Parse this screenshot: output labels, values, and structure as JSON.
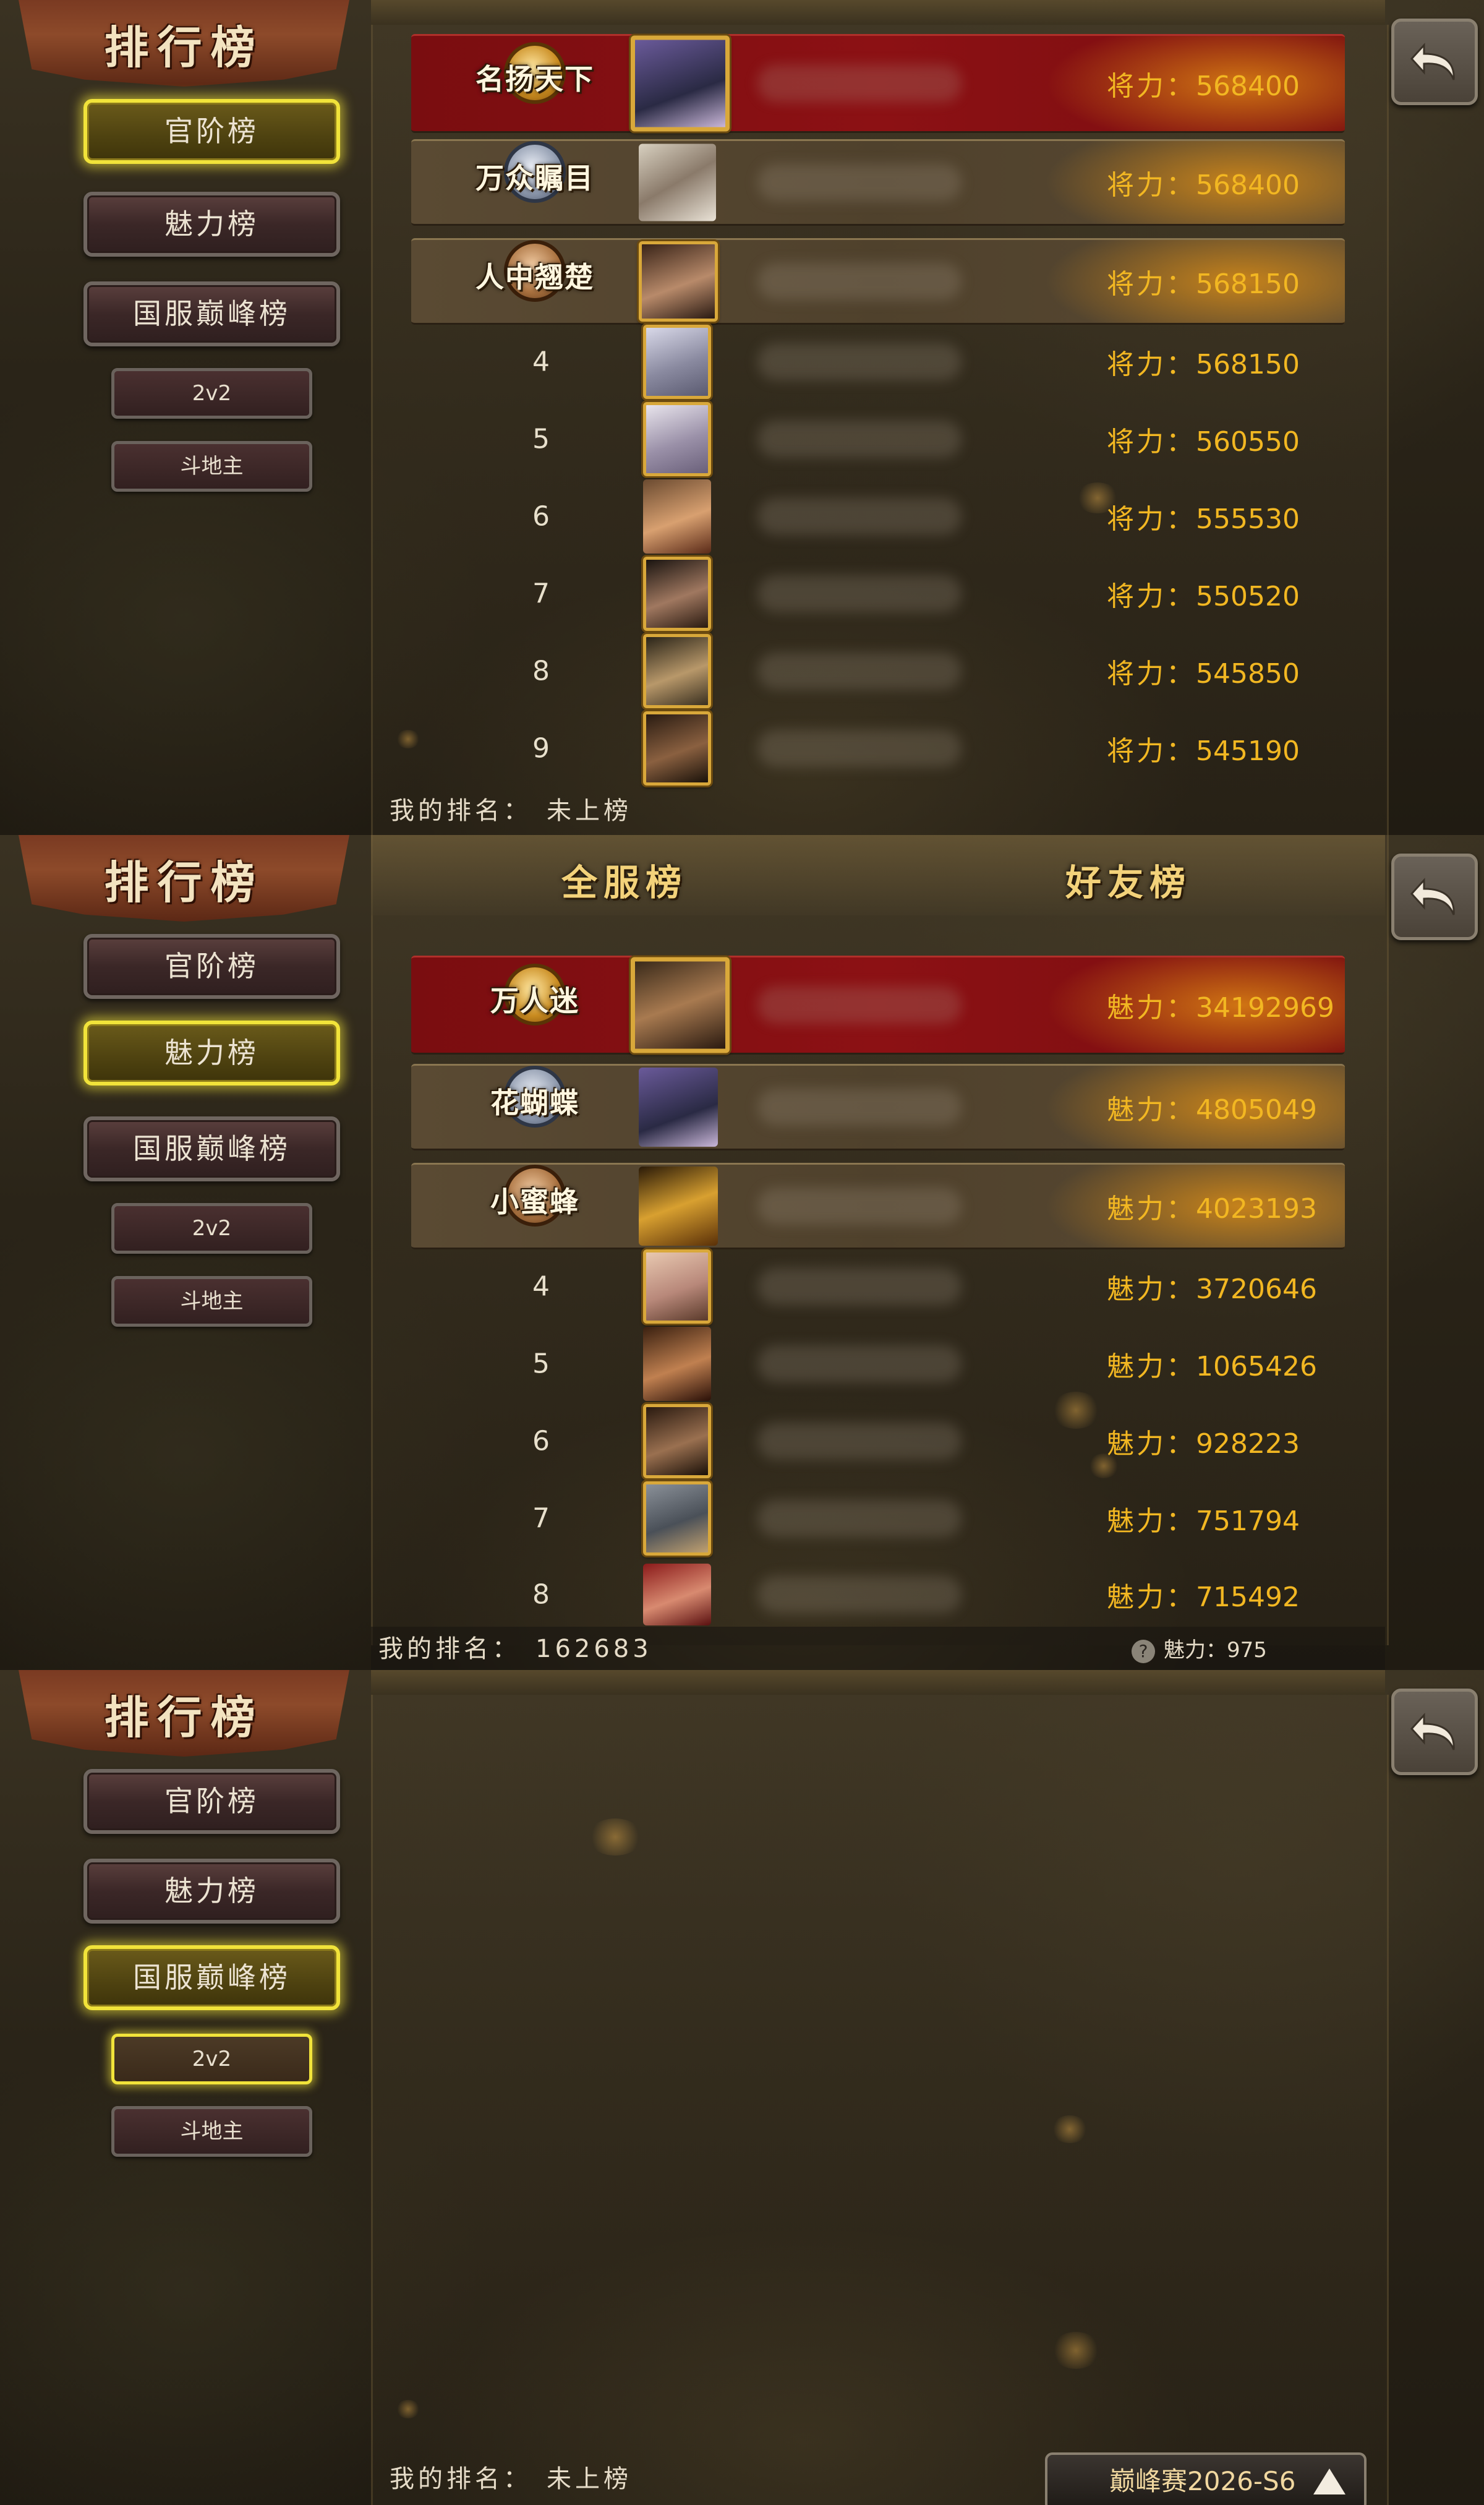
{
  "common": {
    "title": "排行榜",
    "menu": [
      "官阶榜",
      "魅力榜",
      "国服巅峰榜"
    ],
    "sub_menu": [
      "2v2",
      "斗地主"
    ],
    "my_rank_label": "我的排名："
  },
  "screen1": {
    "active_menu": "官阶榜",
    "stat_label": "将力：",
    "rows": [
      {
        "rank": "1",
        "medal_title": "名扬天下",
        "medal": "gold",
        "value": "568400"
      },
      {
        "rank": "2",
        "medal_title": "万众瞩目",
        "medal": "silver",
        "value": "568400"
      },
      {
        "rank": "3",
        "medal_title": "人中翘楚",
        "medal": "bronze",
        "value": "568150"
      },
      {
        "rank": "4",
        "value": "568150"
      },
      {
        "rank": "5",
        "value": "560550"
      },
      {
        "rank": "6",
        "value": "555530"
      },
      {
        "rank": "7",
        "value": "550520"
      },
      {
        "rank": "8",
        "value": "545850"
      },
      {
        "rank": "9",
        "value": "545190"
      }
    ],
    "my_rank_value": "未上榜"
  },
  "screen2": {
    "active_menu": "魅力榜",
    "tabs": [
      "全服榜",
      "好友榜"
    ],
    "stat_label": "魅力：",
    "rows": [
      {
        "rank": "1",
        "medal_title": "万人迷",
        "medal": "gold",
        "value": "34192969"
      },
      {
        "rank": "2",
        "medal_title": "花蝴蝶",
        "medal": "silver",
        "value": "4805049"
      },
      {
        "rank": "3",
        "medal_title": "小蜜蜂",
        "medal": "bronze",
        "value": "4023193"
      },
      {
        "rank": "4",
        "value": "3720646"
      },
      {
        "rank": "5",
        "value": "1065426"
      },
      {
        "rank": "6",
        "value": "928223"
      },
      {
        "rank": "7",
        "value": "751794"
      },
      {
        "rank": "8",
        "value": "715492"
      }
    ],
    "my_rank_value": "162683",
    "my_charm_label": "魅力：",
    "my_charm_value": "975"
  },
  "screen3": {
    "active_menu": "国服巅峰榜",
    "active_sub": "2v2",
    "my_rank_value": "未上榜",
    "season_label": "巅峰赛2026-S6"
  },
  "colors": {
    "accent_gold": "#f2b722",
    "active_border": "#f1e33a",
    "first_row_red": "#8c1114"
  },
  "icons": [
    "back-arrow-icon",
    "question-icon",
    "triangle-up-icon"
  ]
}
